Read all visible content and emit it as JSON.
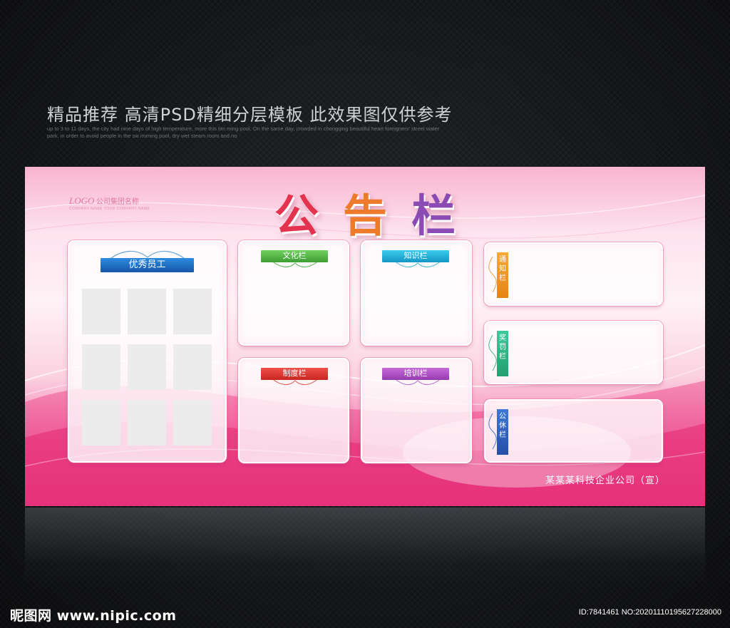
{
  "header": {
    "headline": "精品推荐 高清PSD精细分层模板 此效果图仅供参考",
    "subtext": "up to 3 to 11 days, the city had nine days of high temperature, more this tim ming pool. On the same day, crowded in chongqing beautiful heart foreigners' street water park, in order to avoid people in the sw imming pool, dry wet steam room and no"
  },
  "board": {
    "logo_mark": "LOGO",
    "logo_text": "公司集团名称",
    "logo_sub": "COMPANY NAME YOUR COMPANY NAME",
    "title_chars": [
      "公",
      "告",
      "栏"
    ],
    "panels": {
      "employees": "优秀员工",
      "culture": "文化栏",
      "knowledge": "知识栏",
      "system": "制度栏",
      "training": "培训栏",
      "notice": "通知栏",
      "reward": "奖罚栏",
      "public": "公休栏"
    },
    "company": "某某某科技企业公司（宣）"
  },
  "footer": {
    "brand": "昵图网 www.nipic.com",
    "id_text": "ID:7841461 NO:20201110195627228000"
  },
  "colors": {
    "tag_blue": "#1f6fc2",
    "tag_green": "#4db33f",
    "tag_cyan": "#1fb0d8",
    "tag_red": "#e5362f",
    "tag_purple": "#b24fc7",
    "tag_orange": "#f0921e",
    "tag_teal": "#2fb58a",
    "tag_navy": "#2f5fb8"
  }
}
